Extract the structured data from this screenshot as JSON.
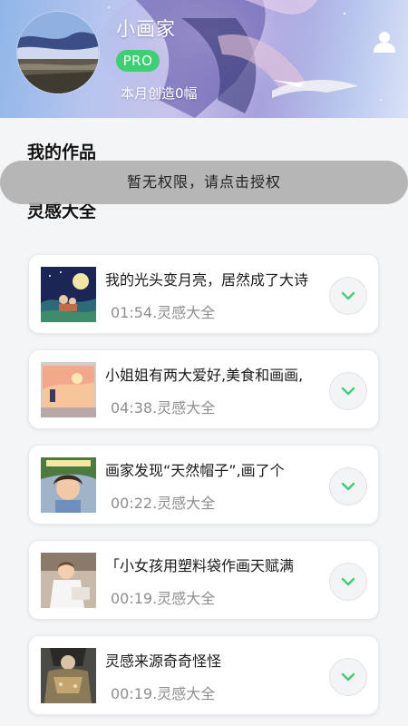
{
  "header": {
    "user_name": "小画家",
    "badge": "PRO",
    "monthly_stat": "本月创造0幅",
    "profile_icon": "user-icon"
  },
  "sections": {
    "works_title": "我的作品",
    "inspiration_title": "灵感大全"
  },
  "toast": {
    "text": "暂无权限，请点击授权"
  },
  "colors": {
    "pro_badge": "#3fcf73",
    "chevron": "#3fcf73",
    "meta_text": "#8e8e93",
    "page_bg": "#f4f5f7"
  },
  "items": [
    {
      "title": "我的光头变月亮，居然成了大诗",
      "meta": "01:54.灵感大全",
      "icon": "chevron-down-icon"
    },
    {
      "title": "小姐姐有两大爱好,美食和画画,",
      "meta": "04:38.灵感大全",
      "icon": "chevron-down-icon"
    },
    {
      "title": "画家发现“天然帽子”,画了个",
      "meta": "00:22.灵感大全",
      "icon": "chevron-down-icon"
    },
    {
      "title": "「小女孩用塑料袋作画天赋满",
      "meta": "00:19.灵感大全",
      "icon": "chevron-down-icon"
    },
    {
      "title": "灵感来源奇奇怪怪",
      "meta": "00:19.灵感大全",
      "icon": "chevron-down-icon"
    }
  ]
}
